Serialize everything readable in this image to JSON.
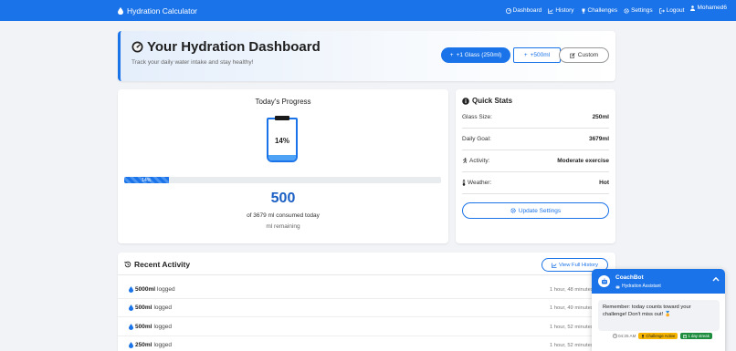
{
  "navbar": {
    "brand": "Hydration Calculator",
    "links": [
      "Dashboard",
      "History",
      "Challenges",
      "Settings",
      "Logout"
    ],
    "user": "Mohamed6"
  },
  "header": {
    "title": "Your Hydration Dashboard",
    "subtitle": "Track your daily water intake and stay healthy!",
    "buttons": {
      "glass": "+1 Glass (250ml)",
      "add500": "+500ml",
      "custom": "Custom"
    }
  },
  "progress": {
    "title": "Today's Progress",
    "percent_label": "14%",
    "percent_value": 14,
    "bar_label": "14%",
    "consumed": "500",
    "consumed_text": "of 3679 ml consumed today",
    "remaining_text": "ml remaining"
  },
  "stats": {
    "title": "Quick Stats",
    "rows": [
      {
        "label": "Glass Size:",
        "value": "250ml"
      },
      {
        "label": "Daily Goal:",
        "value": "3679ml"
      },
      {
        "label": "Activity:",
        "value": "Moderate exercise"
      },
      {
        "label": "Weather:",
        "value": "Hot"
      }
    ],
    "update_button": "Update Settings"
  },
  "activity": {
    "title": "Recent Activity",
    "history_button": "View Full History",
    "items": [
      {
        "amount": "5000ml",
        "suffix": "logged",
        "time": "1 hour, 48 minutes ago"
      },
      {
        "amount": "500ml",
        "suffix": "logged",
        "time": "1 hour, 49 minutes ago"
      },
      {
        "amount": "500ml",
        "suffix": "logged",
        "time": "1 hour, 52 minutes ago"
      },
      {
        "amount": "250ml",
        "suffix": "logged",
        "time": "1 hour, 52 minutes ago"
      }
    ]
  },
  "coachbot": {
    "name": "CoachBot",
    "role": "Hydration Assistant",
    "message": "Remember: today counts toward your challenge! Don't miss out! 🏅",
    "time": "04:25 AM",
    "badge_challenge": "Challenge Active",
    "badge_streak": "1 day streak"
  },
  "colors": {
    "primary": "#1a73e8",
    "water": "#4fa3f7",
    "warning": "#f5b400",
    "success": "#1e8e3e"
  }
}
